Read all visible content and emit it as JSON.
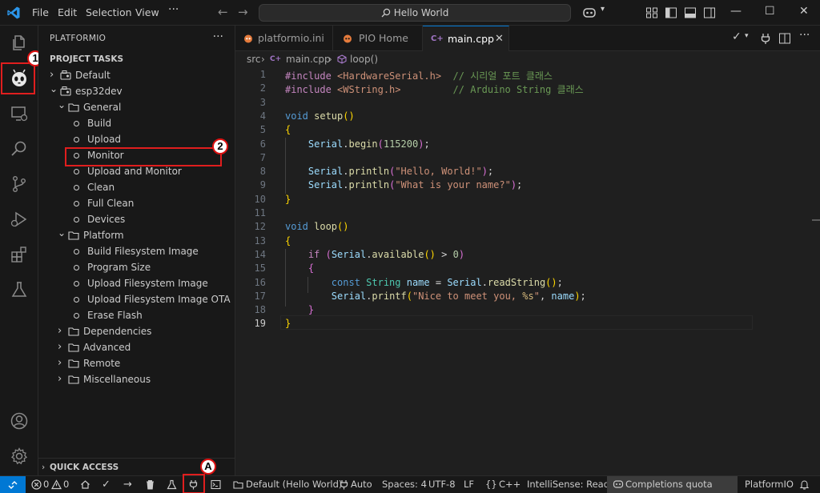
{
  "titlebar": {
    "menu": [
      "File",
      "Edit",
      "Selection",
      "View"
    ],
    "search_text": "Hello World",
    "window_controls": [
      "minimize",
      "maximize",
      "close"
    ]
  },
  "annotations": {
    "badge1": "1",
    "badge2": "2",
    "badgeA": "A",
    "accent": "#e01e1e"
  },
  "sidebar": {
    "title": "PLATFORMIO",
    "section": "PROJECT TASKS",
    "tree": [
      {
        "label": "Default",
        "level": 0,
        "icon": "env-icon",
        "expanded": false
      },
      {
        "label": "esp32dev",
        "level": 0,
        "icon": "env-icon",
        "expanded": true
      },
      {
        "label": "General",
        "level": 1,
        "icon": "folder-icon",
        "expanded": true
      },
      {
        "label": "Build",
        "level": 2,
        "icon": "task-dot"
      },
      {
        "label": "Upload",
        "level": 2,
        "icon": "task-dot"
      },
      {
        "label": "Monitor",
        "level": 2,
        "icon": "task-dot"
      },
      {
        "label": "Upload and Monitor",
        "level": 2,
        "icon": "task-dot"
      },
      {
        "label": "Clean",
        "level": 2,
        "icon": "task-dot"
      },
      {
        "label": "Full Clean",
        "level": 2,
        "icon": "task-dot"
      },
      {
        "label": "Devices",
        "level": 2,
        "icon": "task-dot"
      },
      {
        "label": "Platform",
        "level": 1,
        "icon": "folder-icon",
        "expanded": true
      },
      {
        "label": "Build Filesystem Image",
        "level": 2,
        "icon": "task-dot"
      },
      {
        "label": "Program Size",
        "level": 2,
        "icon": "task-dot"
      },
      {
        "label": "Upload Filesystem Image",
        "level": 2,
        "icon": "task-dot"
      },
      {
        "label": "Upload Filesystem Image OTA",
        "level": 2,
        "icon": "task-dot"
      },
      {
        "label": "Erase Flash",
        "level": 2,
        "icon": "task-dot"
      },
      {
        "label": "Dependencies",
        "level": 1,
        "icon": "folder-icon",
        "expanded": false
      },
      {
        "label": "Advanced",
        "level": 1,
        "icon": "folder-icon",
        "expanded": false
      },
      {
        "label": "Remote",
        "level": 1,
        "icon": "folder-icon",
        "expanded": false
      },
      {
        "label": "Miscellaneous",
        "level": 1,
        "icon": "folder-icon",
        "expanded": false
      }
    ],
    "quick_access": "QUICK ACCESS"
  },
  "tabs": [
    {
      "label": "platformio.ini",
      "icon": "platformio-icon"
    },
    {
      "label": "PIO Home",
      "icon": "pio-home-icon"
    },
    {
      "label": "main.cpp",
      "icon": "cpp-icon",
      "active": true
    }
  ],
  "breadcrumbs": {
    "folder": "src",
    "file": "main.cpp",
    "symbol": "loop()"
  },
  "editor": {
    "current_line": 19,
    "lines": [
      [
        [
          "k-pre",
          "#include "
        ],
        [
          "k-inc",
          "<HardwareSerial.h>"
        ],
        [
          "k-com",
          "  // 시리얼 포트 클래스"
        ]
      ],
      [
        [
          "k-pre",
          "#include "
        ],
        [
          "k-inc",
          "<WString.h>"
        ],
        [
          "k-com",
          "         // Arduino String 클래스"
        ]
      ],
      [],
      [
        [
          "k-kw",
          "void "
        ],
        [
          "k-fn",
          "setup"
        ],
        [
          "k-b1",
          "()"
        ]
      ],
      [
        [
          "k-b1",
          "{"
        ]
      ],
      [
        [
          "",
          "    "
        ],
        [
          "k-var",
          "Serial"
        ],
        [
          "k-op",
          "."
        ],
        [
          "k-fn",
          "begin"
        ],
        [
          "k-b2",
          "("
        ],
        [
          "k-num",
          "115200"
        ],
        [
          "k-b2",
          ")"
        ],
        [
          "k-op",
          ";"
        ]
      ],
      [],
      [
        [
          "",
          "    "
        ],
        [
          "k-var",
          "Serial"
        ],
        [
          "k-op",
          "."
        ],
        [
          "k-fn",
          "println"
        ],
        [
          "k-b2",
          "("
        ],
        [
          "k-str",
          "\"Hello, World!\""
        ],
        [
          "k-b2",
          ")"
        ],
        [
          "k-op",
          ";"
        ]
      ],
      [
        [
          "",
          "    "
        ],
        [
          "k-var",
          "Serial"
        ],
        [
          "k-op",
          "."
        ],
        [
          "k-fn",
          "println"
        ],
        [
          "k-b2",
          "("
        ],
        [
          "k-str",
          "\"What is your name?\""
        ],
        [
          "k-b2",
          ")"
        ],
        [
          "k-op",
          ";"
        ]
      ],
      [
        [
          "k-b1",
          "}"
        ]
      ],
      [],
      [
        [
          "k-kw",
          "void "
        ],
        [
          "k-fn",
          "loop"
        ],
        [
          "k-b1",
          "()"
        ]
      ],
      [
        [
          "k-b1",
          "{"
        ]
      ],
      [
        [
          "",
          "    "
        ],
        [
          "k-ctl",
          "if "
        ],
        [
          "k-b2",
          "("
        ],
        [
          "k-var",
          "Serial"
        ],
        [
          "k-op",
          "."
        ],
        [
          "k-fn",
          "available"
        ],
        [
          "k-b1",
          "()"
        ],
        [
          "k-op",
          " > "
        ],
        [
          "k-num",
          "0"
        ],
        [
          "k-b2",
          ")"
        ]
      ],
      [
        [
          "",
          "    "
        ],
        [
          "k-b2",
          "{"
        ]
      ],
      [
        [
          "",
          "        "
        ],
        [
          "k-kw",
          "const "
        ],
        [
          "k-type",
          "String "
        ],
        [
          "k-var",
          "name"
        ],
        [
          "k-op",
          " = "
        ],
        [
          "k-var",
          "Serial"
        ],
        [
          "k-op",
          "."
        ],
        [
          "k-fn",
          "readString"
        ],
        [
          "k-b1",
          "()"
        ],
        [
          "k-op",
          ";"
        ]
      ],
      [
        [
          "",
          "        "
        ],
        [
          "k-var",
          "Serial"
        ],
        [
          "k-op",
          "."
        ],
        [
          "k-fn",
          "printf"
        ],
        [
          "k-b1",
          "("
        ],
        [
          "k-str",
          "\"Nice to meet you, "
        ],
        [
          "k-esc",
          "%s"
        ],
        [
          "k-str",
          "\""
        ],
        [
          "k-op",
          ", "
        ],
        [
          "k-var",
          "name"
        ],
        [
          "k-b1",
          ")"
        ],
        [
          "k-op",
          ";"
        ]
      ],
      [
        [
          "",
          "    "
        ],
        [
          "k-b2",
          "}"
        ]
      ],
      [
        [
          "k-b1",
          "}"
        ]
      ]
    ]
  },
  "statusbar": {
    "errors": "0",
    "warnings": "0",
    "env": "Default (Hello World)",
    "auto": "Auto",
    "spaces": "Spaces: 4",
    "encoding": "UTF-8",
    "eol": "LF",
    "braces": "{}",
    "language": "C++",
    "intellisense": "IntelliSense: Ready",
    "completions": "Completions quota reached",
    "platformio": "PlatformIO"
  }
}
